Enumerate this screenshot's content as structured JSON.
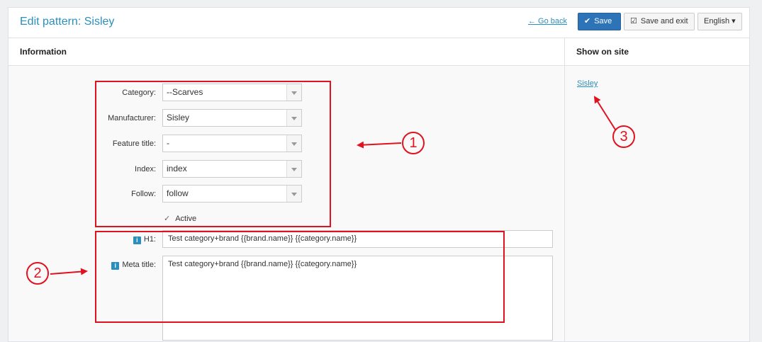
{
  "header": {
    "title": "Edit pattern: Sisley",
    "go_back": "← Go back",
    "save_label": "Save",
    "save_exit_label": "Save and exit",
    "language": "English"
  },
  "information": {
    "heading": "Information",
    "fields": {
      "category_label": "Category:",
      "category_value": "--Scarves",
      "manufacturer_label": "Manufacturer:",
      "manufacturer_value": "Sisley",
      "feature_label": "Feature title:",
      "feature_value": "-",
      "index_label": "Index:",
      "index_value": "index",
      "follow_label": "Follow:",
      "follow_value": "follow",
      "active_label": "Active",
      "h1_label": "H1:",
      "h1_value": "Test category+brand {{brand.name}} {{category.name}}",
      "meta_title_label": "Meta title:",
      "meta_title_value": "Test category+brand {{brand.name}} {{category.name}}"
    }
  },
  "show_on_site": {
    "heading": "Show on site",
    "link": "Sisley"
  },
  "annotations": [
    "1",
    "2",
    "3"
  ],
  "colors": {
    "accent": "#2a8fbd",
    "primary_button": "#2d73b8",
    "annotation": "#e1121f"
  }
}
